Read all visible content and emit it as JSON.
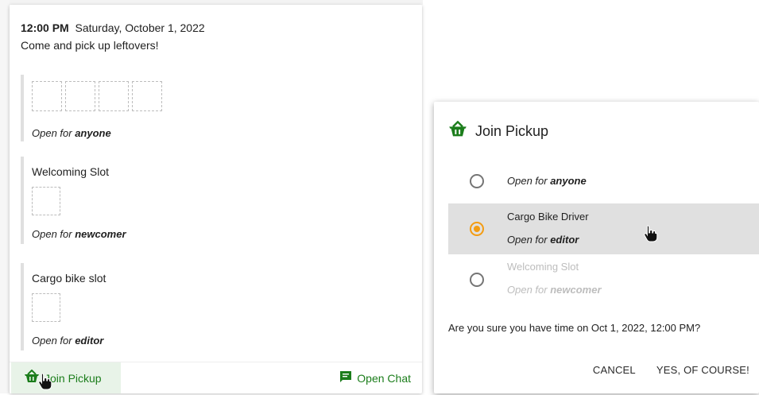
{
  "card": {
    "time": "12:00 PM",
    "date": "Saturday, October 1, 2022",
    "description": "Come and pick up leftovers!",
    "slots": [
      {
        "title": "",
        "open_prefix": "Open for ",
        "role": "anyone"
      },
      {
        "title": "Welcoming Slot",
        "open_prefix": "Open for ",
        "role": "newcomer"
      },
      {
        "title": "Cargo bike slot",
        "open_prefix": "Open for ",
        "role": "editor"
      }
    ],
    "actions": {
      "join": "Join Pickup",
      "chat": "Open Chat"
    }
  },
  "dialog": {
    "title": "Join Pickup",
    "options": [
      {
        "title": "",
        "open_prefix": "Open for ",
        "role": "anyone",
        "selected": false,
        "disabled": false
      },
      {
        "title": "Cargo Bike Driver",
        "open_prefix": "Open for ",
        "role": "editor",
        "selected": true,
        "disabled": false
      },
      {
        "title": "Welcoming Slot",
        "open_prefix": "Open for ",
        "role": "newcomer",
        "selected": false,
        "disabled": true
      }
    ],
    "confirm_text": "Are you sure you have time on Oct 1, 2022, 12:00 PM?",
    "cancel": "CANCEL",
    "ok": "YES, OF COURSE!"
  },
  "colors": {
    "accent": "#1b7d1b",
    "radio_selected": "#f39c12",
    "selected_row": "#e0e0e0",
    "disabled_text": "#bdbdbd"
  },
  "icons": {
    "basket": "basket-icon",
    "chat": "chat-icon",
    "cursor": "hand-pointer-icon"
  }
}
